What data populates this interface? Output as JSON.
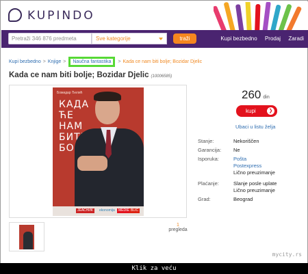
{
  "header": {
    "logo_text": "KUPINDO"
  },
  "nav": {
    "search_placeholder": "Pretraži 346 876 predmeta",
    "category_select": "Sve kategorije",
    "search_button": "traži",
    "links": [
      "Kupi bezbedno",
      "Prodaj",
      "Zaradi"
    ]
  },
  "breadcrumb": {
    "items": [
      "Kupi bezbedno",
      "Knjige",
      "Naučna fantastika"
    ],
    "separator": ">",
    "current": "Kada ce nam biti bolje; Bozidar Djelic",
    "highlight_color": "#57d935"
  },
  "product": {
    "title": "Kada ce nam biti bolje; Bozidar Djelic",
    "id": "(10006585)",
    "views_count": "1",
    "views_label": "pregleda",
    "book_cover": {
      "author_line": "Божидар Ђелић",
      "title_lines": [
        "КАДА",
        "ЋЕ",
        "НАМ",
        "БИТИ",
        "БОЉЕ"
      ],
      "publisher_logos": [
        "ЈЕАСНИК",
        "ekonomija",
        "MEDIE",
        "BLIC"
      ]
    }
  },
  "purchase": {
    "price": "260",
    "currency": "din",
    "buy_label": "kupi",
    "wishlist_label": "Ubaci u listu želja"
  },
  "details": [
    {
      "label": "Stanje:",
      "values": [
        "Nekoriščen"
      ],
      "links": []
    },
    {
      "label": "Garancija:",
      "values": [
        "Ne"
      ],
      "links": []
    },
    {
      "label": "Isporuka:",
      "values": [
        "Lično preuzimanje"
      ],
      "links": [
        "Pošta",
        "Postexpress"
      ]
    },
    {
      "label": "Plaćanje:",
      "values": [
        "Slanje posle uplate",
        "Lično preuzimanje"
      ],
      "links": []
    },
    {
      "label": "Grad:",
      "values": [
        "Beograd"
      ],
      "links": []
    }
  ],
  "footer": {
    "watermark": "mycity.rs",
    "click_label": "Klik za veću"
  },
  "colors": {
    "nav_bg": "#4a2470",
    "accent_orange": "#f5861f",
    "buy_red": "#e3121d",
    "link_blue": "#2e6db0"
  }
}
